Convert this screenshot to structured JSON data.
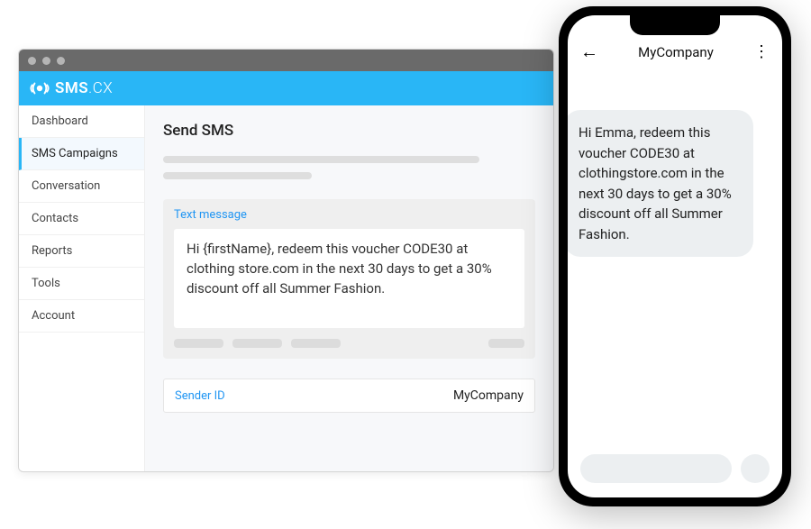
{
  "brand": {
    "name_bold": "SMS",
    "name_thin": ".CX"
  },
  "sidebar": {
    "items": [
      {
        "label": "Dashboard",
        "active": false
      },
      {
        "label": "SMS Campaigns",
        "active": true
      },
      {
        "label": "Conversation",
        "active": false
      },
      {
        "label": "Contacts",
        "active": false
      },
      {
        "label": "Reports",
        "active": false
      },
      {
        "label": "Tools",
        "active": false
      },
      {
        "label": "Account",
        "active": false
      }
    ]
  },
  "page": {
    "title": "Send SMS",
    "text_message_label": "Text message",
    "message_body": "Hi {firstName}, redeem this voucher CODE30 at clothing store.com in the next 30 days to get a 30% discount off all Summer Fashion.",
    "sender_id_label": "Sender ID",
    "sender_id_value": "MyCompany"
  },
  "phone": {
    "contact": "MyCompany",
    "message": "Hi Emma, redeem this voucher CODE30 at clothingstore.com in the next 30 days to get a 30% discount off all Summer Fashion."
  }
}
